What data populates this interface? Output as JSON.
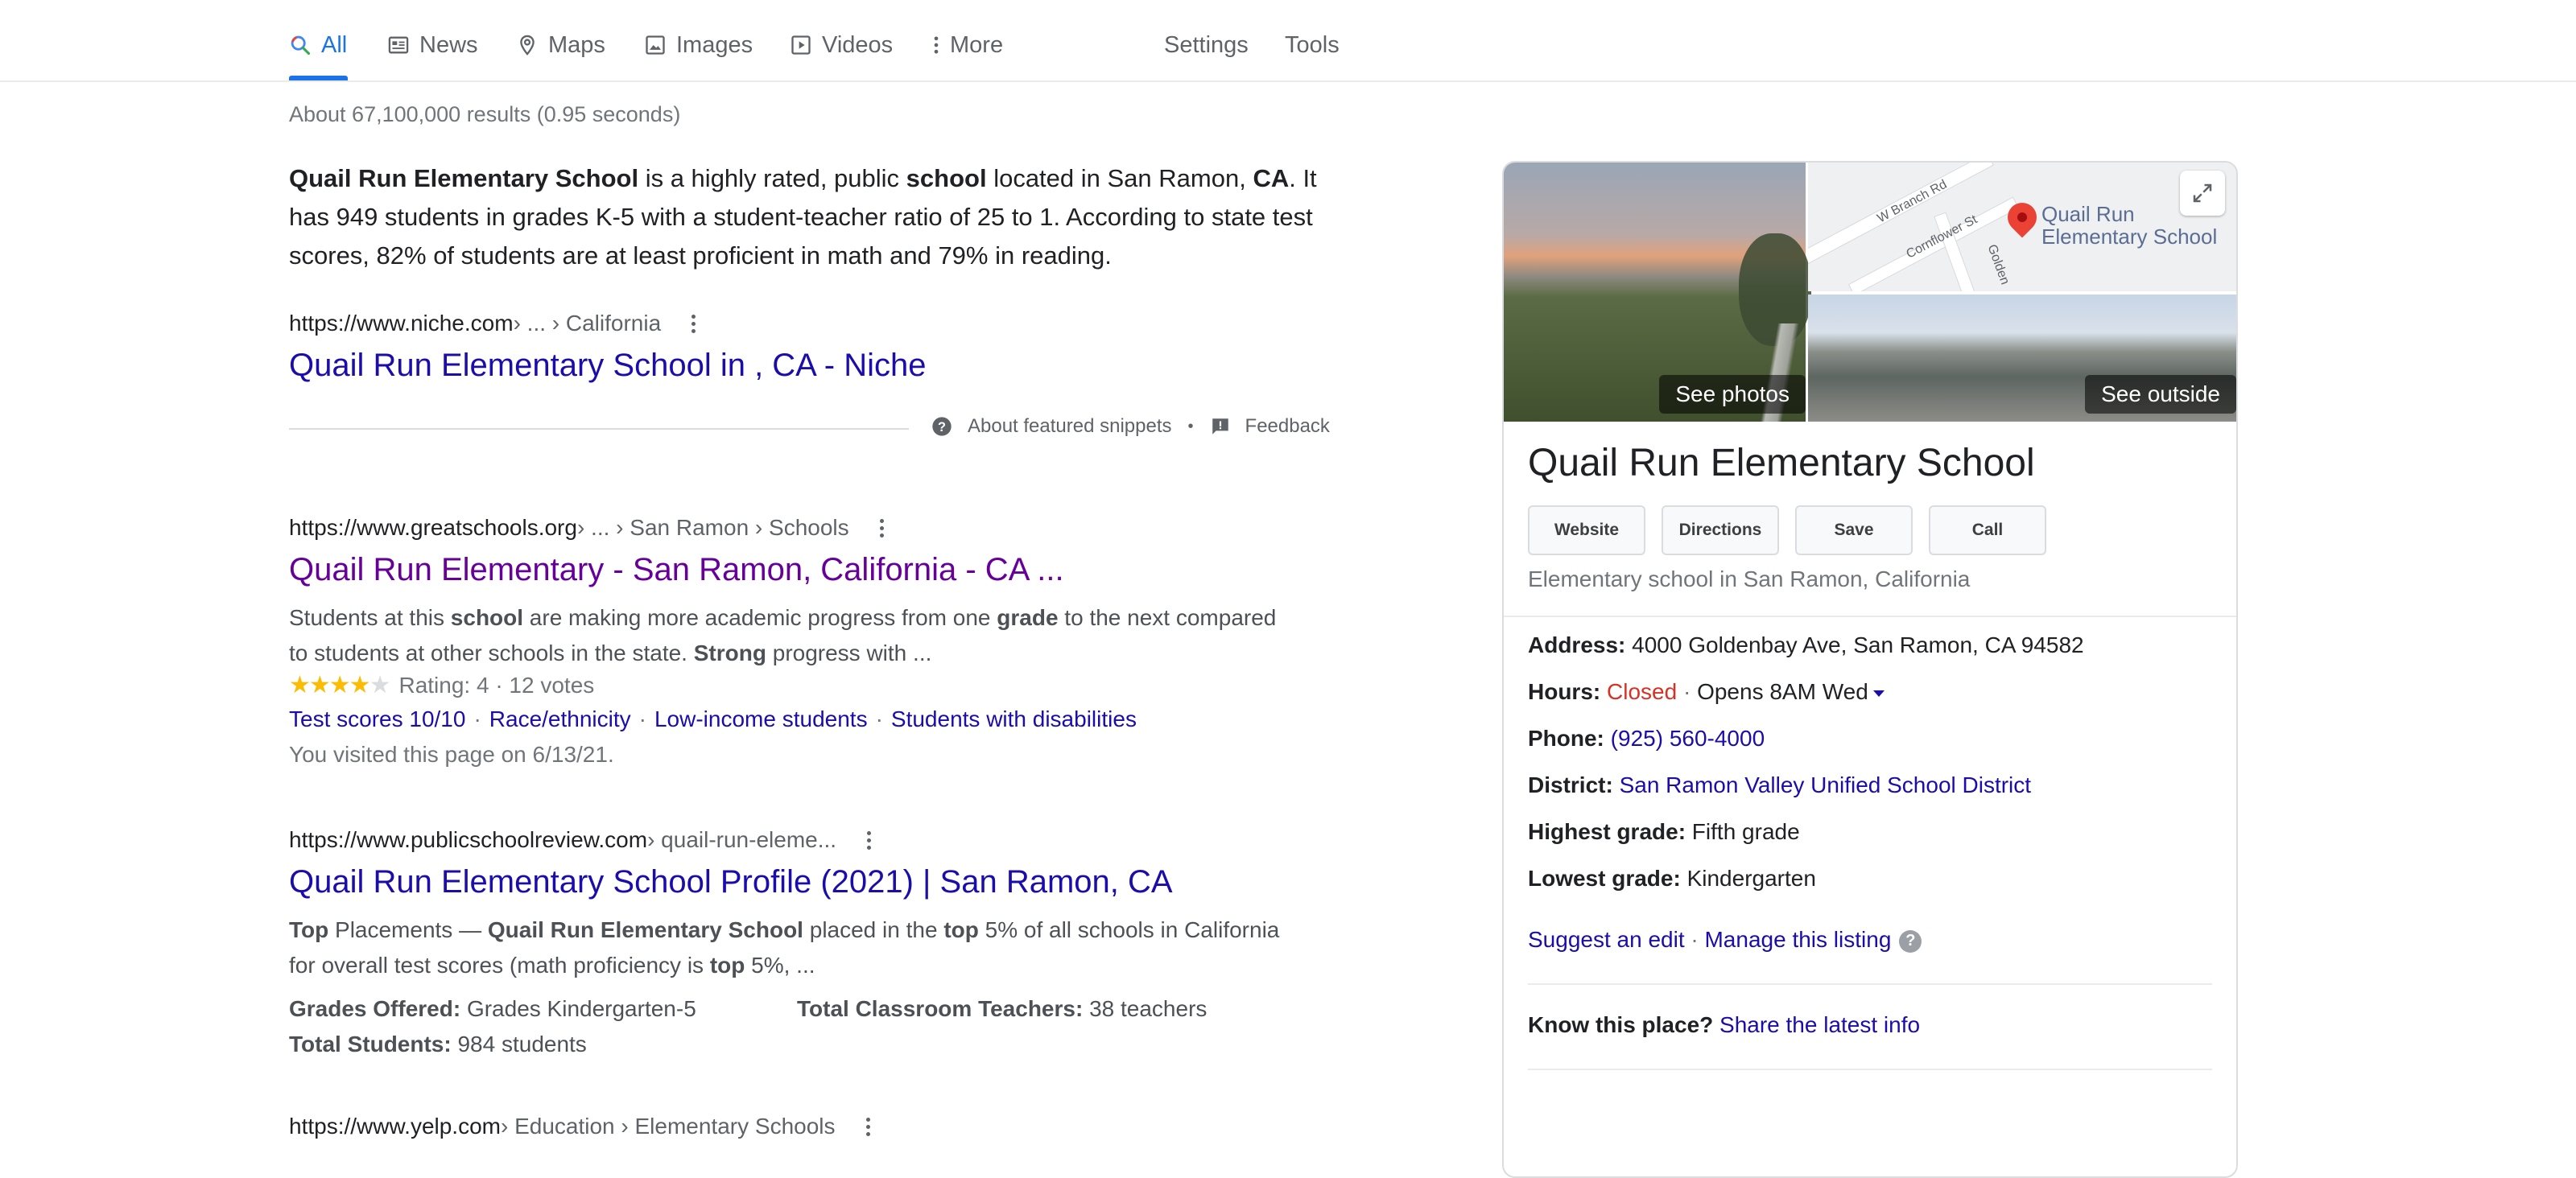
{
  "nav": {
    "tabs": [
      {
        "label": "All",
        "icon": "search-icon"
      },
      {
        "label": "News",
        "icon": "news-icon"
      },
      {
        "label": "Maps",
        "icon": "map-pin-icon"
      },
      {
        "label": "Images",
        "icon": "image-icon"
      },
      {
        "label": "Videos",
        "icon": "video-icon"
      },
      {
        "label": "More",
        "icon": "more-vert-icon"
      }
    ],
    "settings": "Settings",
    "tools": "Tools",
    "active_color": "#1a73e8"
  },
  "result_stats": "About 67,100,000 results (0.95 seconds)",
  "featured": {
    "s1": "Quail Run Elementary School",
    "s2": " is a highly rated, public ",
    "s3": "school",
    "s4": " located in San Ramon, ",
    "s5": "CA",
    "s6": ". It has 949 students in grades K-5 with a student-teacher ratio of 25 to 1. According to state test scores, 82% of students are at least proficient in math and 79% in reading.",
    "cite_domain": "https://www.niche.com",
    "cite_path": " › ... › California",
    "title": "Quail Run Elementary School in , CA - Niche",
    "about_label": "About featured snippets",
    "feedback_label": "Feedback"
  },
  "results": [
    {
      "cite_domain": "https://www.greatschools.org",
      "cite_path": " › ... › San Ramon › Schools",
      "title": "Quail Run Elementary - San Ramon, California - CA ...",
      "d1": "Students at this ",
      "d2": "school",
      "d3": " are making more academic progress from one ",
      "d4": "grade",
      "d5": " to the next compared to students at other schools in the state. ",
      "d6": "Strong",
      "d7": " progress with ...",
      "rating_text": "Rating: 4 · 12 votes",
      "rating_value": 4,
      "rating_max": 5,
      "sitelinks": [
        "Test scores 10/10",
        "Race/ethnicity",
        "Low-income students",
        "Students with disabilities"
      ],
      "visited": "You visited this page on 6/13/21."
    },
    {
      "cite_domain": "https://www.publicschoolreview.com",
      "cite_path": " › quail-run-eleme...",
      "title": "Quail Run Elementary School Profile (2021) | San Ramon, CA",
      "d1": "Top",
      "d2": " Placements — ",
      "d3": "Quail Run Elementary School",
      "d4": " placed in the ",
      "d5": "top",
      "d6": " 5% of all schools in California for overall test scores (math proficiency is ",
      "d7": "top",
      "d8": " 5%, ...",
      "facts": [
        {
          "label": "Grades Offered:",
          "value": " Grades Kindergarten-5"
        },
        {
          "label": "Total Classroom Teachers:",
          "value": " 38 teachers"
        },
        {
          "label": "Total Students:",
          "value": " 984 students"
        }
      ]
    },
    {
      "cite_domain": "https://www.yelp.com",
      "cite_path": " › Education › Elementary Schools"
    }
  ],
  "kp": {
    "see_photos": "See photos",
    "see_outside": "See outside",
    "map_labels": {
      "road1": "W Branch Rd",
      "road2": "Cornflower St",
      "road3": "Golden",
      "school": "Quail Run Elementary School"
    },
    "name": "Quail Run Elementary School",
    "actions": [
      "Website",
      "Directions",
      "Save",
      "Call"
    ],
    "subtitle": "Elementary school in San Ramon, California",
    "address_label": "Address:",
    "address": " 4000 Goldenbay Ave, San Ramon, CA 94582",
    "hours_label": "Hours:",
    "hours_status": "Closed",
    "hours_sep": " · ",
    "hours_next": "Opens 8AM Wed",
    "phone_label": "Phone:",
    "phone": "(925) 560-4000",
    "district_label": "District:",
    "district": "San Ramon Valley Unified School District",
    "highest_label": "Highest grade:",
    "highest": " Fifth grade",
    "lowest_label": "Lowest grade:",
    "lowest": " Kindergarten",
    "suggest": "Suggest an edit",
    "sep": " · ",
    "manage": "Manage this listing",
    "know_label": "Know this place?",
    "share": "Share the latest info"
  }
}
